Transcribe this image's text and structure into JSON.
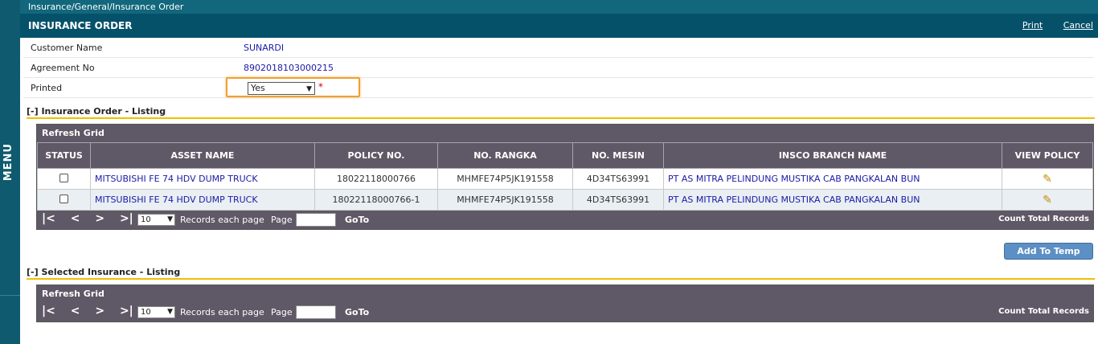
{
  "menu": {
    "label": "MENU"
  },
  "breadcrumb": "Insurance/General/Insurance Order",
  "header": {
    "title": "INSURANCE ORDER",
    "print": "Print",
    "cancel": "Cancel"
  },
  "form": {
    "customer_label": "Customer Name",
    "customer_value": "SUNARDI",
    "agreement_label": "Agreement No",
    "agreement_value": "8902018103000215",
    "printed_label": "Printed",
    "printed_value": "Yes",
    "required_mark": "*"
  },
  "order_listing": {
    "section_title": "[-] Insurance Order - Listing",
    "grid_title": "Refresh Grid",
    "columns": [
      "STATUS",
      "ASSET NAME",
      "POLICY NO.",
      "NO. RANGKA",
      "NO. MESIN",
      "INSCO BRANCH NAME",
      "VIEW POLICY"
    ],
    "rows": [
      {
        "asset": "MITSUBISHI FE 74 HDV DUMP TRUCK",
        "policy": "18022118000766",
        "rangka": "MHMFE74P5JK191558",
        "mesin": "4D34TS63991",
        "branch": "PT AS MITRA PELINDUNG MUSTIKA CAB PANGKALAN BUN"
      },
      {
        "asset": "MITSUBISHI FE 74 HDV DUMP TRUCK",
        "policy": "18022118000766-1",
        "rangka": "MHMFE74P5JK191558",
        "mesin": "4D34TS63991",
        "branch": "PT AS MITRA PELINDUNG MUSTIKA CAB PANGKALAN BUN"
      }
    ]
  },
  "pager": {
    "first": "|<",
    "prev": "<",
    "next": ">",
    "last": ">|",
    "page_size": "10",
    "records_label": "Records each page",
    "page_label": "Page",
    "goto_label": "GoTo",
    "count_label": "Count Total Records"
  },
  "add_to_temp": "Add To Temp",
  "selected_listing": {
    "section_title": "[-] Selected Insurance - Listing",
    "grid_title": "Refresh Grid"
  },
  "colors": {
    "titlebar": "#06516a",
    "grid_header": "#5f5866",
    "link": "#1a1aa6",
    "accent": "#f0c000"
  }
}
